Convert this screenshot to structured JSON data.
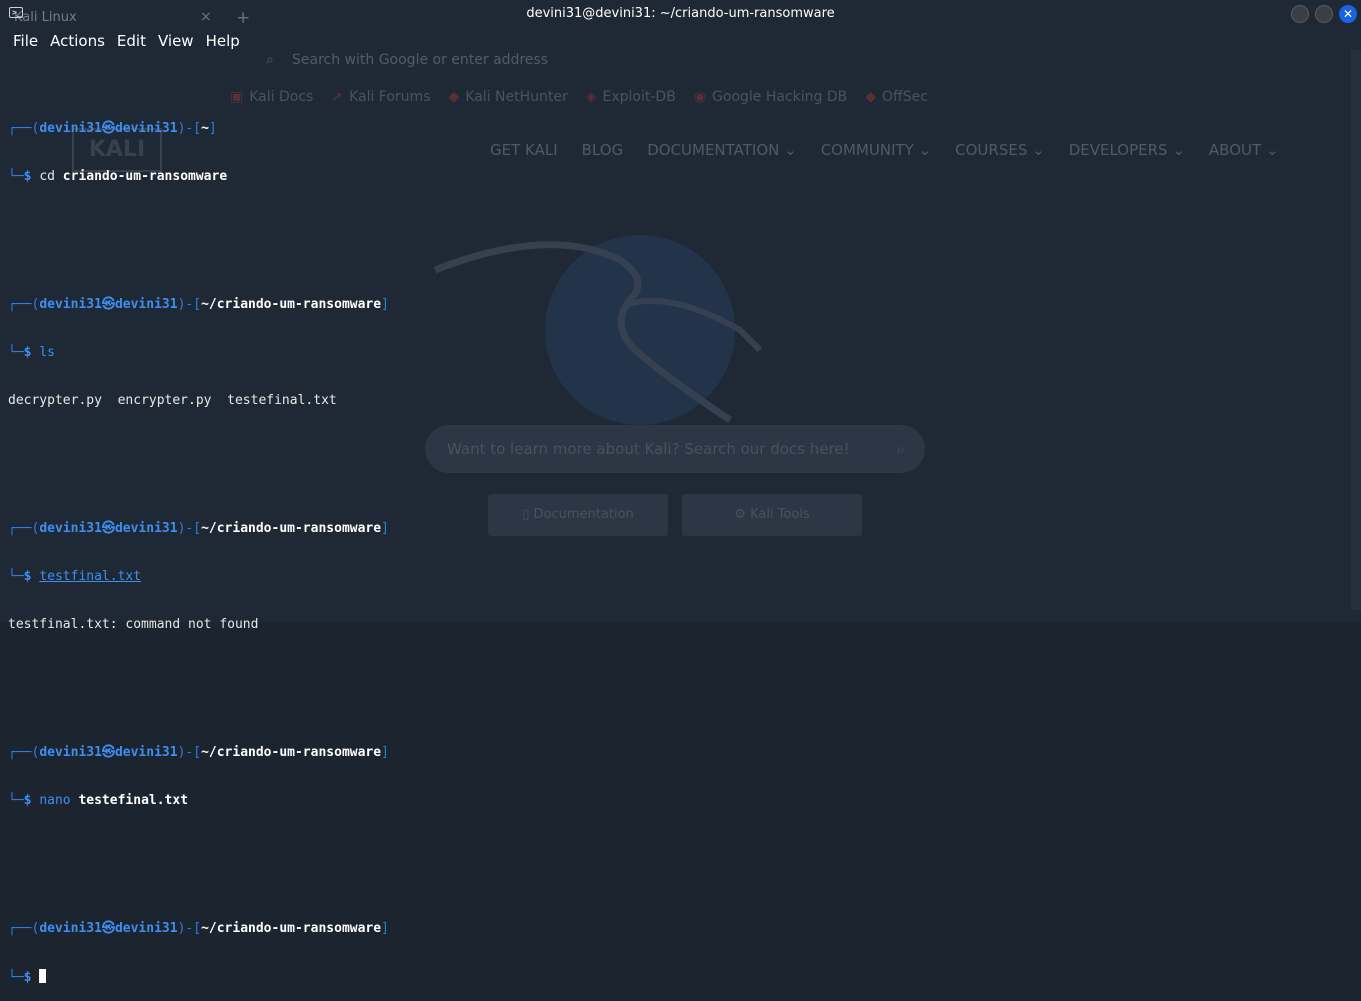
{
  "background_browser": {
    "tab_label": "Kali Linux",
    "tab_close": "×",
    "tab_new": "+",
    "address_placeholder": "Search with Google or enter address",
    "bookmarks": [
      "Kali Docs",
      "Kali Forums",
      "Kali NetHunter",
      "Exploit-DB",
      "Google Hacking DB",
      "OffSec"
    ],
    "logo_text": "KALI",
    "nav": [
      "GET KALI",
      "BLOG",
      "DOCUMENTATION ⌄",
      "COMMUNITY ⌄",
      "COURSES ⌄",
      "DEVELOPERS ⌄",
      "ABOUT ⌄"
    ],
    "search_placeholder": "Want to learn more about Kali? Search our docs here!",
    "buttons": {
      "documentation": "Documentation",
      "tools": "Kali Tools"
    }
  },
  "window": {
    "title": "devini31@devini31: ~/criando-um-ransomware",
    "close_glyph": "✕"
  },
  "menu": [
    "File",
    "Actions",
    "Edit",
    "View",
    "Help"
  ],
  "terminal": {
    "user": "devini31",
    "host": "devini31",
    "at": "㉿",
    "home_path": "~",
    "project_path": "~/criando-um-ransomware",
    "blocks": [
      {
        "path": "~",
        "cmd": "cd",
        "arg": "criando-um-ransomware",
        "output": ""
      },
      {
        "path": "~/criando-um-ransomware",
        "cmd": "ls",
        "arg": "",
        "output": "decrypter.py  encrypter.py  testefinal.txt"
      },
      {
        "path": "~/criando-um-ransomware",
        "cmd": "testfinal.txt",
        "arg": "",
        "output": "testfinal.txt: command not found"
      },
      {
        "path": "~/criando-um-ransomware",
        "cmd": "nano",
        "arg": "testefinal.txt",
        "output": ""
      },
      {
        "path": "~/criando-um-ransomware",
        "cmd": "",
        "arg": "",
        "output": ""
      }
    ]
  },
  "colors": {
    "prompt_blue": "#3f8ef0",
    "close_button": "#1a63e5",
    "background": "#1c2430"
  }
}
